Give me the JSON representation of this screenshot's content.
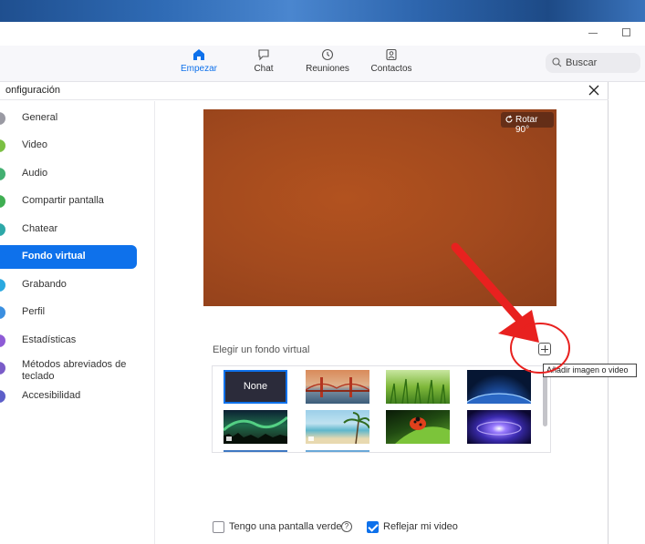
{
  "window": {
    "min_icon": "minimize-icon",
    "max_icon": "maximize-icon"
  },
  "nav": {
    "items": [
      {
        "label": "Empezar",
        "icon": "home-icon",
        "active": true
      },
      {
        "label": "Chat",
        "icon": "chat-icon",
        "active": false
      },
      {
        "label": "Reuniones",
        "icon": "clock-icon",
        "active": false
      },
      {
        "label": "Contactos",
        "icon": "contacts-icon",
        "active": false
      }
    ],
    "search_label": "Buscar"
  },
  "dialog": {
    "title": "onfiguración",
    "close_icon": "close-icon"
  },
  "sidebar": {
    "items": [
      {
        "label": "General",
        "color": "#9a9aa3"
      },
      {
        "label": "Video",
        "color": "#7bc043"
      },
      {
        "label": "Audio",
        "color": "#43b072"
      },
      {
        "label": "Compartir pantalla",
        "color": "#3fae52"
      },
      {
        "label": "Chatear",
        "color": "#2ea8a8"
      },
      {
        "label": "Fondo virtual",
        "color": "#0e71eb",
        "active": true
      },
      {
        "label": "Grabando",
        "color": "#2aa9e0"
      },
      {
        "label": "Perfil",
        "color": "#3b8fe0"
      },
      {
        "label": "Estadísticas",
        "color": "#8e5bd6"
      },
      {
        "label": "Métodos abreviados de teclado",
        "color": "#7a5cc8"
      },
      {
        "label": "Accesibilidad",
        "color": "#5d5fc9"
      }
    ]
  },
  "content": {
    "rotate_label": "Rotar 90°",
    "choose_label": "Elegir un fondo virtual",
    "add_tooltip": "Añadir imagen o video",
    "thumbs": [
      {
        "kind": "none",
        "label": "None"
      },
      {
        "kind": "golden-gate"
      },
      {
        "kind": "grass"
      },
      {
        "kind": "earth"
      },
      {
        "kind": "aurora"
      },
      {
        "kind": "beach"
      },
      {
        "kind": "ladybug"
      },
      {
        "kind": "galaxy"
      }
    ],
    "green_screen_label": "Tengo una pantalla verde",
    "green_screen_checked": false,
    "mirror_label": "Reflejar mi video",
    "mirror_checked": true
  },
  "colors": {
    "accent": "#0e71eb",
    "annotation": "#e8211f"
  }
}
